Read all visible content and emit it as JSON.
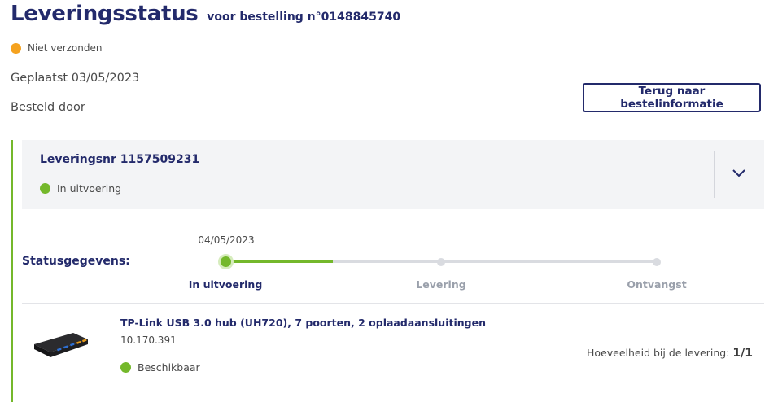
{
  "header": {
    "title": "Leveringsstatus",
    "subtitle": "voor bestelling n°0148845740"
  },
  "order": {
    "status": "Niet verzonden",
    "status_color": "#f5a21f",
    "placed": "Geplaatst 03/05/2023",
    "ordered_by": "Besteld door",
    "back_button": "Terug naar bestelinformatie"
  },
  "delivery": {
    "number_label": "Leveringsnr 1157509231",
    "status": "In uitvoering",
    "status_color": "#74b82b",
    "expand_icon": "chevron-down-icon",
    "status_details_label": "Statusgegevens:",
    "progress_fraction": 0.25,
    "steps": [
      {
        "label": "In uitvoering",
        "date": "04/05/2023",
        "active": true
      },
      {
        "label": "Levering",
        "date": "",
        "active": false
      },
      {
        "label": "Ontvangst",
        "date": "",
        "active": false
      }
    ]
  },
  "product": {
    "image_icon": "usb-hub-image",
    "name": "TP-Link USB 3.0 hub (UH720), 7 poorten, 2 oplaadaansluitingen",
    "sku": "10.170.391",
    "availability": "Beschikbaar",
    "availability_color": "#74b82b",
    "quantity_label": "Hoeveelheid bij de levering:",
    "quantity_value": "1/1"
  },
  "colors": {
    "brand": "#232a6b",
    "accent_green": "#74b82b"
  }
}
